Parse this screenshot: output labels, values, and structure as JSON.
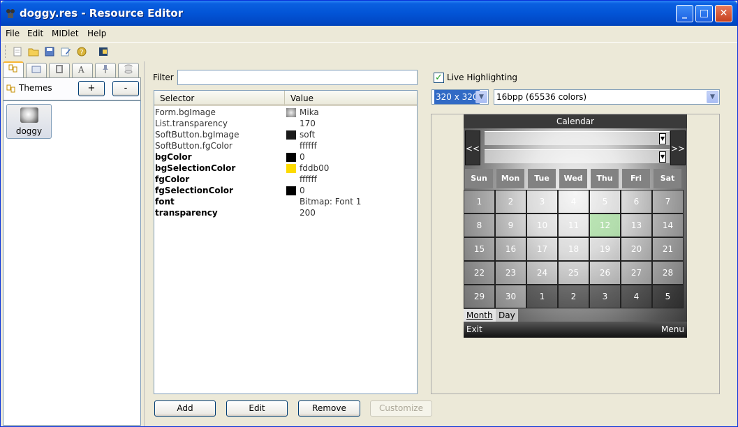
{
  "window": {
    "title": "doggy.res - Resource Editor",
    "minimize": "_",
    "maximize": "□",
    "close": "✕"
  },
  "menu": [
    "File",
    "Edit",
    "MIDlet",
    "Help"
  ],
  "left": {
    "section_label": "Themes",
    "add_label": "+",
    "remove_label": "-",
    "items": [
      {
        "label": "doggy"
      }
    ]
  },
  "filter": {
    "label": "Filter",
    "value": ""
  },
  "table": {
    "columns": [
      "Selector",
      "Value"
    ],
    "rows": [
      {
        "selector": "Form.bgImage",
        "value": "Mika",
        "bold": false,
        "swatch": "image"
      },
      {
        "selector": "List.transparency",
        "value": "170",
        "bold": false,
        "swatch": ""
      },
      {
        "selector": "SoftButton.bgImage",
        "value": "soft",
        "bold": false,
        "swatch": "#1a1a1a"
      },
      {
        "selector": "SoftButton.fgColor",
        "value": "ffffff",
        "bold": false,
        "swatch": "#ffffff"
      },
      {
        "selector": "bgColor",
        "value": "0",
        "bold": true,
        "swatch": "#000000"
      },
      {
        "selector": "bgSelectionColor",
        "value": "fddb00",
        "bold": true,
        "swatch": "#fddb00"
      },
      {
        "selector": "fgColor",
        "value": "ffffff",
        "bold": true,
        "swatch": "#ffffff"
      },
      {
        "selector": "fgSelectionColor",
        "value": "0",
        "bold": true,
        "swatch": "#000000"
      },
      {
        "selector": "font",
        "value": "Bitmap: Font 1",
        "bold": true,
        "swatch": ""
      },
      {
        "selector": "transparency",
        "value": "200",
        "bold": true,
        "swatch": ""
      }
    ]
  },
  "buttons": {
    "add": "Add",
    "edit": "Edit",
    "remove": "Remove",
    "customize": "Customize"
  },
  "preview": {
    "live_highlighting_label": "Live Highlighting",
    "live_highlighting_checked": true,
    "resolution": "320 x 320",
    "color_depth": "16bpp (65536 colors)"
  },
  "calendar": {
    "title": "Calendar",
    "prev": "<<",
    "next": ">>",
    "spin1": "▼",
    "spin2": "▼",
    "day_names": [
      "Sun",
      "Mon",
      "Tue",
      "Wed",
      "Thu",
      "Fri",
      "Sat"
    ],
    "weeks": [
      [
        "1",
        "2",
        "3",
        "4",
        "5",
        "6",
        "7"
      ],
      [
        "8",
        "9",
        "10",
        "11",
        "12",
        "13",
        "14"
      ],
      [
        "15",
        "16",
        "17",
        "18",
        "19",
        "20",
        "21"
      ],
      [
        "22",
        "23",
        "24",
        "25",
        "26",
        "27",
        "28"
      ],
      [
        "29",
        "30",
        "1",
        "2",
        "3",
        "4",
        "5"
      ]
    ],
    "selected_day": "12",
    "tabs": [
      "Month",
      "Day"
    ],
    "softkey_left": "Exit",
    "softkey_right": "Menu"
  }
}
